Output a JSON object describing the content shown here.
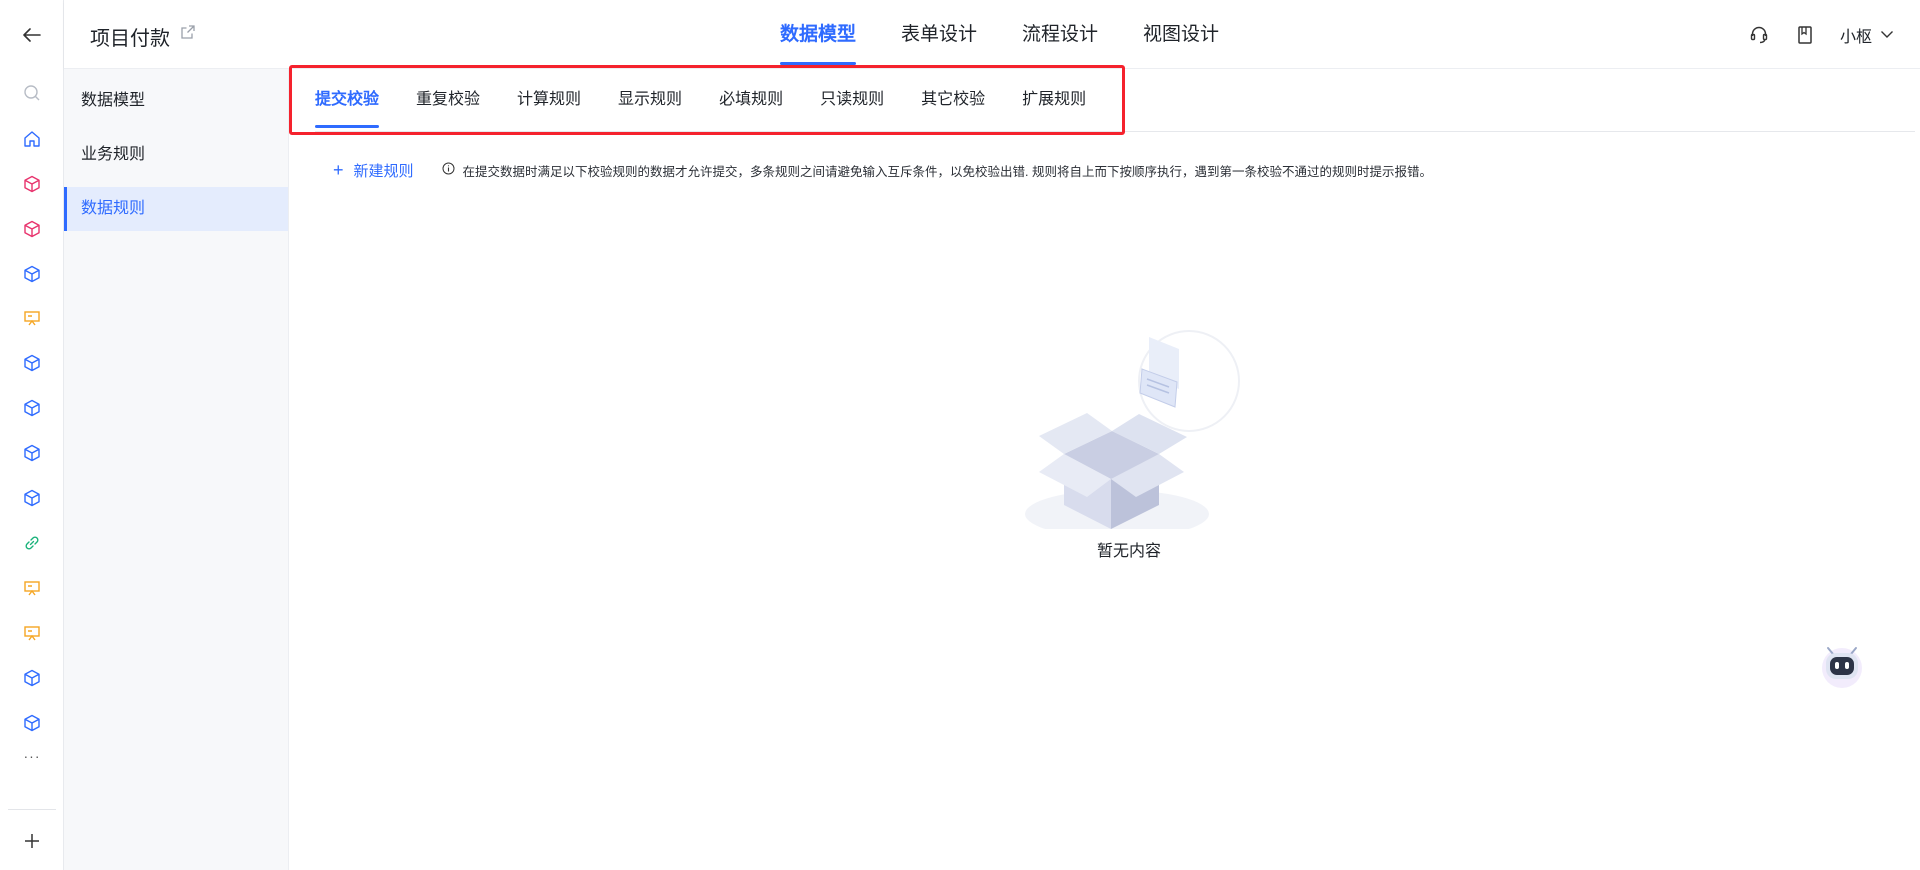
{
  "colors": {
    "accent": "#2f6bff",
    "highlight": "#f5222d",
    "sidebar_active_bg": "#e4ecfd"
  },
  "header": {
    "title": "项目付款",
    "tabs": [
      {
        "label": "数据模型",
        "active": true
      },
      {
        "label": "表单设计",
        "active": false
      },
      {
        "label": "流程设计",
        "active": false
      },
      {
        "label": "视图设计",
        "active": false
      }
    ],
    "user_name": "小枢",
    "icons": [
      "headset-icon",
      "document-icon",
      "chevron-down-icon"
    ]
  },
  "rail": {
    "icons": [
      "back-arrow-icon",
      "search-icon",
      "home-icon",
      "cube-icon",
      "cube-icon",
      "cube-icon",
      "presentation-icon",
      "cube-icon",
      "cube-icon",
      "cube-icon",
      "cube-icon",
      "link-icon",
      "presentation-icon",
      "presentation-icon",
      "cube-icon",
      "cube-icon",
      "plus-icon"
    ],
    "more": "···"
  },
  "sidebar": {
    "items": [
      {
        "label": "数据模型",
        "active": false
      },
      {
        "label": "业务规则",
        "active": false
      },
      {
        "label": "数据规则",
        "active": true
      }
    ]
  },
  "main": {
    "tabs": [
      {
        "label": "提交校验",
        "active": true
      },
      {
        "label": "重复校验",
        "active": false
      },
      {
        "label": "计算规则",
        "active": false
      },
      {
        "label": "显示规则",
        "active": false
      },
      {
        "label": "必填规则",
        "active": false
      },
      {
        "label": "只读规则",
        "active": false
      },
      {
        "label": "其它校验",
        "active": false
      },
      {
        "label": "扩展规则",
        "active": false
      }
    ],
    "new_rule_label": "新建规则",
    "hint": "在提交数据时满足以下校验规则的数据才允许提交，多条规则之间请避免输入互斥条件，以免校验出错. 规则将自上而下按顺序执行，遇到第一条校验不通过的规则时提示报错。",
    "empty_label": "暂无内容"
  }
}
